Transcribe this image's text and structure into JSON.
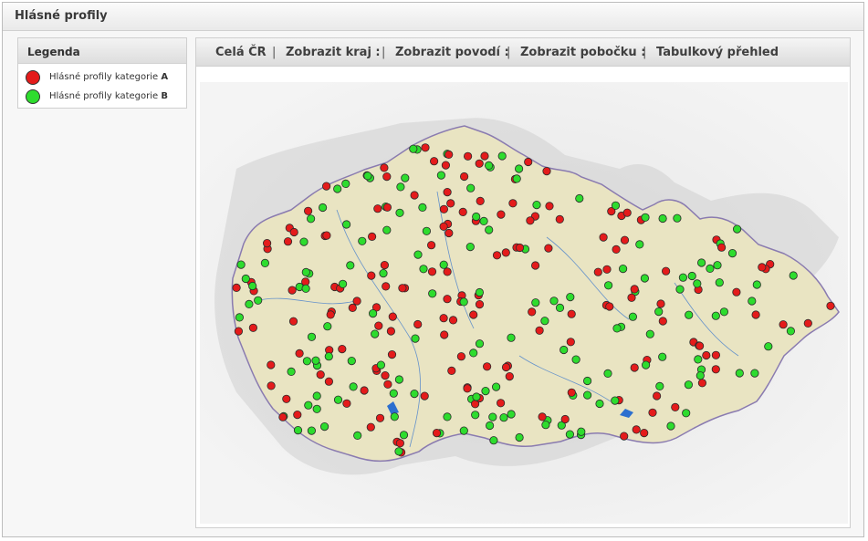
{
  "page": {
    "title": "Hlásné profily"
  },
  "legend": {
    "title": "Legenda",
    "items": [
      {
        "label_prefix": "Hlásné profily kategorie",
        "category": "A",
        "color": "#e41b1b"
      },
      {
        "label_prefix": "Hlásné profily kategorie",
        "category": "B",
        "color": "#2edc2e"
      }
    ]
  },
  "nav": {
    "items": [
      "Celá ČR",
      "Zobrazit kraj :",
      "Zobrazit povodí :",
      "Zobrazit pobočku :",
      "Tabulkový přehled"
    ],
    "separator": "|"
  },
  "colors": {
    "terrain": "#e8e3c4",
    "water": "#2c6fcf",
    "border": "#8a7bb0",
    "shade": "#d8d8d8"
  }
}
